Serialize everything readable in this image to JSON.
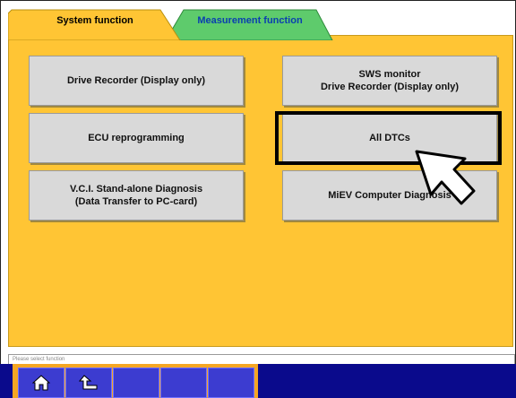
{
  "tabs": {
    "system_label": "System function",
    "measurement_label": "Measurement function"
  },
  "buttons": {
    "drive_recorder": "Drive Recorder (Display only)",
    "sws_monitor": "SWS monitor\nDrive Recorder (Display only)",
    "ecu_reprogramming": "ECU reprogramming",
    "all_dtcs": "All DTCs",
    "vci_standalone": "V.C.I. Stand-alone Diagnosis\n(Data Transfer to PC-card)",
    "miev_diagnosis": "MiEV Computer Diagnosis"
  },
  "status": {
    "message": "Please select function"
  },
  "taskbar": {
    "home_icon": "home-icon",
    "back_icon": "back-arrow-icon"
  },
  "colors": {
    "panel": "#ffc534",
    "active_tab": "#ffc534",
    "inactive_tab": "#5ecb6c",
    "taskbar": "#0a0a8c",
    "taskbar_accent": "#f5a623"
  }
}
